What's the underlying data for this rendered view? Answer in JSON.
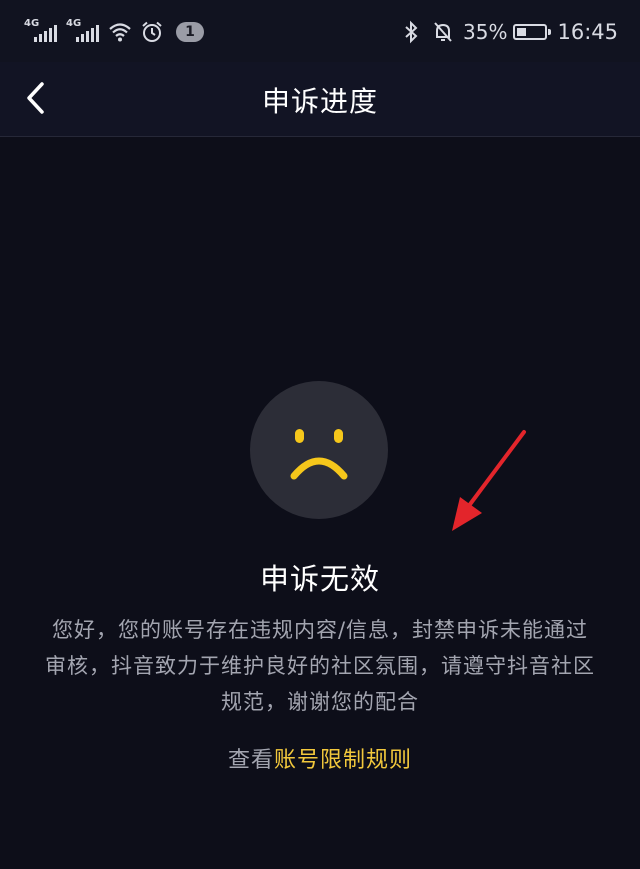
{
  "status_bar": {
    "signal_1_label": "4G",
    "signal_2_label": "4G",
    "notification_count": "1",
    "battery_percent": "35%",
    "battery_level": 0.35,
    "time": "16:45",
    "icons": [
      "signal-icon",
      "signal-icon",
      "wifi-icon",
      "alarm-icon",
      "bluetooth-icon",
      "mute-icon",
      "battery-icon"
    ]
  },
  "nav": {
    "title": "申诉进度",
    "back_icon": "chevron-left-icon"
  },
  "result": {
    "icon": "sad-face-icon",
    "title": "申诉无效",
    "description": "您好，您的账号存在违规内容/信息，封禁申诉未能通过审核，抖音致力于维护良好的社区氛围，请遵守抖音社区规范，谢谢您的配合",
    "rules_prefix": "查看",
    "rules_link": "账号限制规则"
  },
  "annotation": {
    "icon": "red-arrow-icon"
  },
  "colors": {
    "background": "#0d0e19",
    "nav_background": "#121424",
    "face_circle": "#2c2d37",
    "face_features": "#f6c71b",
    "accent": "#f2c83c",
    "secondary_text": "#a3a5b0",
    "arrow": "#e3252b"
  }
}
